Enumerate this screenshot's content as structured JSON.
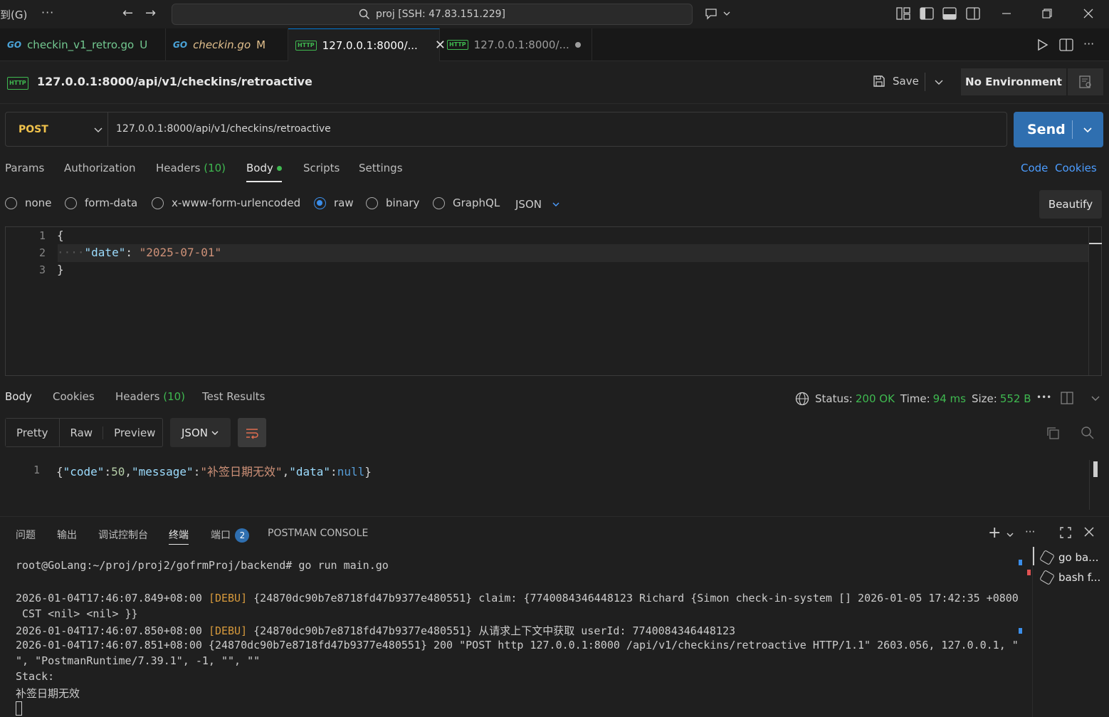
{
  "titlebar": {
    "menu_fragment": "到(G)",
    "more": "···",
    "search_text": "proj [SSH: 47.83.151.229]"
  },
  "tabs": [
    {
      "label": "checkin_v1_retro.go",
      "badge": "U",
      "type": "go"
    },
    {
      "label": "checkin.go",
      "badge": "M",
      "type": "go"
    },
    {
      "label": "127.0.0.1:8000/...",
      "type": "http",
      "active": true
    },
    {
      "label": "127.0.0.1:8000/...",
      "type": "http"
    }
  ],
  "request": {
    "title": "127.0.0.1:8000/api/v1/checkins/retroactive",
    "save_label": "Save",
    "environment": "No Environment",
    "method": "POST",
    "url": "127.0.0.1:8000/api/v1/checkins/retroactive",
    "send_label": "Send",
    "tabs": {
      "params": "Params",
      "authorization": "Authorization",
      "headers": "Headers",
      "headers_count": "(10)",
      "body": "Body",
      "scripts": "Scripts",
      "settings": "Settings"
    },
    "code_link": "Code",
    "cookies_link": "Cookies",
    "body_options": [
      "none",
      "form-data",
      "x-www-form-urlencoded",
      "raw",
      "binary",
      "GraphQL"
    ],
    "body_format": "JSON",
    "beautify_label": "Beautify",
    "body_lines": {
      "l1": "{",
      "l2_key": "\"date\"",
      "l2_sep": ": ",
      "l2_val": "\"2025-07-01\"",
      "l3": "}"
    }
  },
  "response": {
    "tabs": {
      "body": "Body",
      "cookies": "Cookies",
      "headers": "Headers",
      "headers_count": "(10)",
      "tests": "Test Results"
    },
    "status_label": "Status:",
    "status_value": "200 OK",
    "time_label": "Time:",
    "time_value": "94 ms",
    "size_label": "Size:",
    "size_value": "552 B",
    "views": [
      "Pretty",
      "Raw",
      "Preview"
    ],
    "format": "JSON",
    "body": {
      "open": "{",
      "k1": "\"code\"",
      "v1": "50",
      "k2": "\"message\"",
      "v2": "\"补签日期无效\"",
      "k3": "\"data\"",
      "v3": "null",
      "close": "}"
    }
  },
  "panel": {
    "tabs": [
      "问题",
      "输出",
      "调试控制台",
      "终端",
      "端口",
      "POSTMAN CONSOLE"
    ],
    "ports_badge": "2",
    "terminal_lines": [
      "root@GoLang:~/proj/proj2/gofrmProj/backend# go run main.go",
      "",
      "2026-01-04T17:46:07.849+08:00 ",
      "[DEBU]",
      " {24870dc90b7e8718fd47b9377e480551} claim: {7740084346448123 Richard {Simon check-in-system [] 2026-01-05 17:42:35 +0800",
      " CST <nil> <nil> }}",
      "2026-01-04T17:46:07.850+08:00 ",
      "[DEBU]",
      " {24870dc90b7e8718fd47b9377e480551} 从请求上下文中获取 userId: 7740084346448123",
      "2026-01-04T17:46:07.851+08:00 {24870dc90b7e8718fd47b9377e480551} 200 \"POST http 127.0.0.1:8000 /api/v1/checkins/retroactive HTTP/1.1\" 2603.056, 127.0.0.1, \"",
      "\", \"PostmanRuntime/7.39.1\", -1, \"\", \"\"",
      "Stack:",
      "补签日期无效"
    ],
    "terminals": [
      {
        "label": "go ba..."
      },
      {
        "label": "bash f..."
      }
    ]
  },
  "colors": {
    "accent": "#2f6fb0",
    "method": "#f0c24b",
    "status_ok": "#3fb950",
    "link": "#4c9dff"
  }
}
